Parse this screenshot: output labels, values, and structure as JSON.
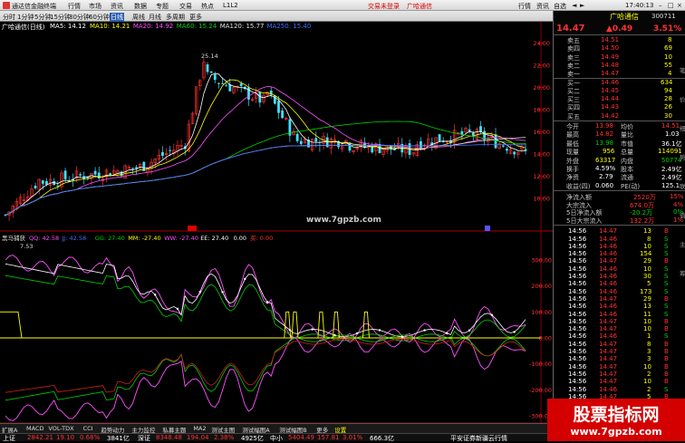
{
  "menubar": {
    "title": "通达信金融终端",
    "items": [
      "行情",
      "市场",
      "资讯",
      "数据",
      "专题",
      "交易",
      "热点",
      "L1L2"
    ],
    "login": "交易未登录",
    "stock": "广哈通信",
    "right": [
      "行情",
      "资讯",
      "自选",
      "◄",
      "►"
    ],
    "time": "17:40:13"
  },
  "toolbar": {
    "items": [
      "分时",
      "1分钟",
      "5分钟",
      "15分钟",
      "30分钟",
      "60分钟",
      "日线",
      "周线",
      "月线",
      "多周期",
      "更多"
    ],
    "selected": "日线"
  },
  "price_title": {
    "name": "广哈通信(日线)",
    "indicators": [
      {
        "label": "MA5: 14.12",
        "color": "#ffffff"
      },
      {
        "label": "MA10: 14.21",
        "color": "#ffff00"
      },
      {
        "label": "MA20: 14.92",
        "color": "#ff50ff"
      },
      {
        "label": "MA60: 15.24",
        "color": "#00d200"
      },
      {
        "label": "MA120: 15.77",
        "color": "#e0e0e0"
      },
      {
        "label": "MA250: 15.40",
        "color": "#4070ff"
      }
    ]
  },
  "price_axis": [
    "24.00",
    "22.00",
    "20.00",
    "18.00",
    "16.00",
    "14.00",
    "12.00",
    "10.00"
  ],
  "price_annotations": {
    "high": "25.14",
    "low": "7.53"
  },
  "watermark_mid": "www.7gpzb.com",
  "ind_title": {
    "name": "黑马捕获",
    "items": [
      {
        "label": "QQ: 42.58",
        "color": "#ff50ff"
      },
      {
        "label": "JJ: 42.58",
        "color": "#4070ff"
      },
      {
        "label": "GG: 27.40",
        "color": "#00d200"
      },
      {
        "label": "MM: -27.40",
        "color": "#ffff00"
      },
      {
        "label": "WW: -27.40",
        "color": "#ff50ff"
      },
      {
        "label": "EE: 27.40",
        "color": "#ffffff"
      },
      {
        "label": "0.00",
        "color": "#ffffff"
      },
      {
        "label": "买: 0.00",
        "color": "#ff3232"
      }
    ]
  },
  "ind_axis": [
    "300.00",
    "200.00",
    "100.00",
    "0.00",
    "-100.00",
    "-200.00",
    "-300.00"
  ],
  "time_labels": [
    "2024年",
    "9",
    "10",
    "11",
    "12",
    "2024/04/12/五",
    "5",
    "6",
    "7",
    "8",
    "9"
  ],
  "bottom_tabs": [
    "扩展A",
    "MACD",
    "VOL-TDX",
    "CCI",
    "趋势动力",
    "主力监控",
    "私募主题",
    "MA2",
    "测试主图",
    "测试幅图A",
    "测试幅图B",
    "更多",
    "设置"
  ],
  "bottom_tabs2": [
    "扩展A",
    "资讯分析",
    "资金分布",
    "综合资讯",
    "行业研究",
    "互动问答",
    "普及版功能说明"
  ],
  "statusbar": [
    {
      "t": "上证",
      "c": "white"
    },
    {
      "t": "2842.21",
      "c": "red"
    },
    {
      "t": "19.10",
      "c": "red"
    },
    {
      "t": "0.68%",
      "c": "red"
    },
    {
      "t": "3841亿",
      "c": "white"
    },
    {
      "t": "深证",
      "c": "white"
    },
    {
      "t": "8348.48",
      "c": "red"
    },
    {
      "t": "194.04",
      "c": "red"
    },
    {
      "t": "2.38%",
      "c": "red"
    },
    {
      "t": "4925亿",
      "c": "white"
    },
    {
      "t": "中小",
      "c": "white"
    },
    {
      "t": "5404.49",
      "c": "red"
    },
    {
      "t": "157.81",
      "c": "red"
    },
    {
      "t": "3.01%",
      "c": "red"
    },
    {
      "t": "666.3亿",
      "c": "white"
    },
    {
      "t": "平安证券新疆云行情",
      "c": "white"
    }
  ],
  "right_panel": {
    "name": "广哈通信",
    "code": "300711",
    "price": "14.47",
    "change": "▲0.49",
    "pct": "3.51%",
    "sells": [
      {
        "l": "卖五",
        "p": "14.51",
        "v": "8"
      },
      {
        "l": "卖四",
        "p": "14.50",
        "v": "69"
      },
      {
        "l": "卖三",
        "p": "14.49",
        "v": "10"
      },
      {
        "l": "卖二",
        "p": "14.48",
        "v": "55"
      },
      {
        "l": "卖一",
        "p": "14.47",
        "v": "4"
      }
    ],
    "buys": [
      {
        "l": "买一",
        "p": "14.46",
        "v": "634"
      },
      {
        "l": "买二",
        "p": "14.45",
        "v": "94"
      },
      {
        "l": "买三",
        "p": "14.44",
        "v": "28"
      },
      {
        "l": "买四",
        "p": "14.43",
        "v": "26"
      },
      {
        "l": "买五",
        "p": "14.42",
        "v": "30"
      }
    ],
    "stats": [
      {
        "l1": "今开",
        "v1": "13.98",
        "l2": "均价",
        "v2": "14.51"
      },
      {
        "l1": "最高",
        "v1": "14.82",
        "l2": "量比",
        "v2": "1.03"
      },
      {
        "l1": "最低",
        "v1": "13.98",
        "l2": "市值",
        "v2": "36.1亿"
      },
      {
        "l1": "现量",
        "v1": "956",
        "l2": "总量",
        "v2": "114091"
      },
      {
        "l1": "外盘",
        "v1": "63317",
        "l2": "内盘",
        "v2": "50774"
      },
      {
        "l1": "换手",
        "v1": "4.59%",
        "l2": "股本",
        "v2": "2.49亿"
      },
      {
        "l1": "净资",
        "v1": "2.79",
        "l2": "流通",
        "v2": "2.49亿"
      },
      {
        "l1": "收益(四)",
        "v1": "0.060",
        "l2": "PE(动)",
        "v2": "125.1"
      }
    ],
    "flows": [
      {
        "l": "净流入额",
        "v": "2520万",
        "p": "15%"
      },
      {
        "l": "大宗流入",
        "v": "674.0万",
        "p": "4%"
      },
      {
        "l": "5日净流入额",
        "v": "-20.2万",
        "p": "0%"
      },
      {
        "l": "5日大宗流入",
        "v": "132.2万",
        "p": "1%"
      }
    ],
    "ticks": [
      {
        "t": "14:56",
        "p": "14.47",
        "v": "13",
        "s": "B"
      },
      {
        "t": "14:56",
        "p": "14.46",
        "v": "8",
        "s": "S"
      },
      {
        "t": "14:56",
        "p": "14.46",
        "v": "10",
        "s": "S"
      },
      {
        "t": "14:56",
        "p": "14.46",
        "v": "154",
        "s": "S"
      },
      {
        "t": "14:56",
        "p": "14.47",
        "v": "29",
        "s": "B"
      },
      {
        "t": "14:56",
        "p": "14.46",
        "v": "10",
        "s": "S"
      },
      {
        "t": "14:56",
        "p": "14.46",
        "v": "30",
        "s": "S"
      },
      {
        "t": "14:56",
        "p": "14.46",
        "v": "5",
        "s": "S"
      },
      {
        "t": "14:56",
        "p": "14.46",
        "v": "173",
        "s": "S"
      },
      {
        "t": "14:56",
        "p": "14.47",
        "v": "29",
        "s": "B"
      },
      {
        "t": "14:56",
        "p": "14.46",
        "v": "13",
        "s": "S"
      },
      {
        "t": "14:56",
        "p": "14.46",
        "v": "11",
        "s": "S"
      },
      {
        "t": "14:56",
        "p": "14.47",
        "v": "10",
        "s": "B"
      },
      {
        "t": "14:56",
        "p": "14.47",
        "v": "10",
        "s": "B"
      },
      {
        "t": "14:56",
        "p": "14.46",
        "v": "1",
        "s": "S"
      },
      {
        "t": "14:56",
        "p": "14.47",
        "v": "8",
        "s": "B"
      },
      {
        "t": "14:56",
        "p": "14.47",
        "v": "3",
        "s": "B"
      },
      {
        "t": "14:56",
        "p": "14.47",
        "v": "3",
        "s": "B"
      },
      {
        "t": "14:56",
        "p": "14.47",
        "v": "10",
        "s": "B"
      },
      {
        "t": "14:56",
        "p": "14.47",
        "v": "2",
        "s": "B"
      },
      {
        "t": "14:56",
        "p": "14.47",
        "v": "10",
        "s": "B"
      },
      {
        "t": "14:56",
        "p": "14.46",
        "v": "2",
        "s": "S"
      },
      {
        "t": "14:56",
        "p": "14.47",
        "v": "5",
        "s": "B"
      }
    ],
    "tabs": [
      "笔",
      "价",
      "细",
      "势",
      "联",
      "值",
      "主",
      "筹"
    ]
  },
  "watermark": {
    "line1": "股票指标网",
    "line2": "www.7gpzb.com"
  }
}
